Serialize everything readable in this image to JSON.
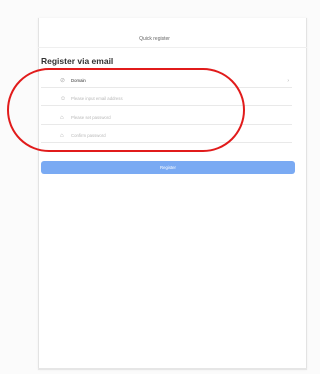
{
  "header": {
    "title": "Quick register"
  },
  "section": {
    "title": "Register via email"
  },
  "fields": {
    "domain": {
      "value": "Domain",
      "icon": "link-icon",
      "trailing_icon": "chevron-right-icon"
    },
    "username": {
      "placeholder": "Please input email address",
      "icon": "user-icon"
    },
    "password": {
      "placeholder": "Please set password",
      "icon": "lock-icon"
    },
    "confirm": {
      "placeholder": "Confirm password",
      "icon": "lock-icon"
    }
  },
  "actions": {
    "register_label": "Register"
  },
  "annotation": {
    "color": "#e11b1b"
  },
  "colors": {
    "accent": "#7aaaf3"
  }
}
